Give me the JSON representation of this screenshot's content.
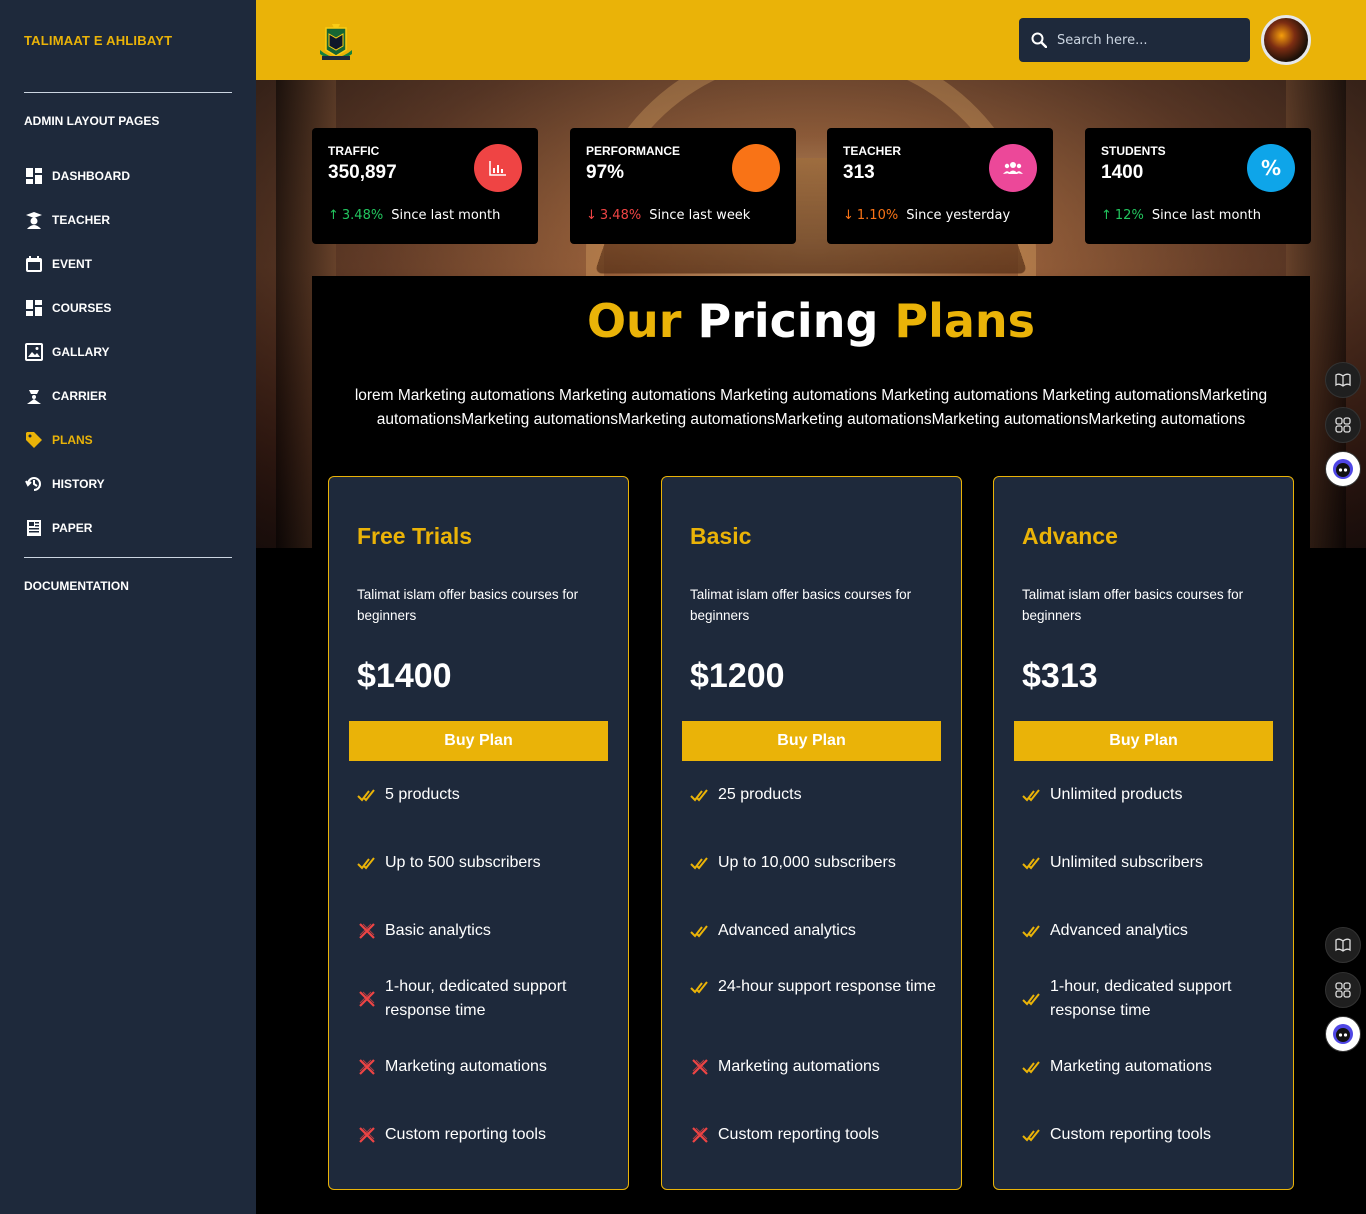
{
  "sidebar": {
    "brand": "TALIMAAT E AHLIBAYT",
    "section_heading": "ADMIN LAYOUT PAGES",
    "items": [
      {
        "label": "DASHBOARD",
        "icon": "dashboard-icon"
      },
      {
        "label": "TEACHER",
        "icon": "teacher-icon"
      },
      {
        "label": "EVENT",
        "icon": "calendar-icon"
      },
      {
        "label": "COURSES",
        "icon": "courses-icon"
      },
      {
        "label": "GALLARY",
        "icon": "gallery-icon"
      },
      {
        "label": "CARRIER",
        "icon": "carrier-icon"
      },
      {
        "label": "PLANS",
        "icon": "tag-icon",
        "active": true
      },
      {
        "label": "HISTORY",
        "icon": "history-icon"
      },
      {
        "label": "PAPER",
        "icon": "newspaper-icon"
      }
    ],
    "documentation": "DOCUMENTATION"
  },
  "header": {
    "search_placeholder": "Search here..."
  },
  "stats": [
    {
      "title": "TRAFFIC",
      "value": "350,897",
      "trend": "up",
      "change": "3.48%",
      "since": "Since last month",
      "color": "#ef4444",
      "icon": "chart-icon"
    },
    {
      "title": "PERFORMANCE",
      "value": "97%",
      "trend": "down",
      "change": "3.48%",
      "since": "Since last week",
      "color": "#f97316",
      "icon": "pie-icon"
    },
    {
      "title": "TEACHER",
      "value": "313",
      "trend": "down",
      "change": "1.10%",
      "since": "Since yesterday",
      "color": "#ec4899",
      "icon": "users-icon"
    },
    {
      "title": "STUDENTS",
      "value": "1400",
      "trend": "up",
      "change": "12%",
      "since": "Since last month",
      "color": "#0ea5e9",
      "icon": "percent-icon"
    }
  ],
  "pricing": {
    "title_part1": "Our",
    "title_part2": "Pricing",
    "title_part3": "Plans",
    "intro": "lorem Marketing automations Marketing automations Marketing automations Marketing automations Marketing automationsMarketing automationsMarketing automationsMarketing automationsMarketing automationsMarketing automationsMarketing automations",
    "plans": [
      {
        "name": "Free Trials",
        "description": "Talimat islam offer basics courses for beginners",
        "price": "$1400",
        "button": "Buy Plan",
        "features": [
          {
            "text": "5 products",
            "included": true
          },
          {
            "text": "Up to 500 subscribers",
            "included": true
          },
          {
            "text": "Basic analytics",
            "included": false
          },
          {
            "text": "1-hour, dedicated support response time",
            "included": false
          },
          {
            "text": "Marketing automations",
            "included": false
          },
          {
            "text": "Custom reporting tools",
            "included": false
          }
        ]
      },
      {
        "name": "Basic",
        "description": "Talimat islam offer basics courses for beginners",
        "price": "$1200",
        "button": "Buy Plan",
        "features": [
          {
            "text": "25 products",
            "included": true
          },
          {
            "text": "Up to 10,000 subscribers",
            "included": true
          },
          {
            "text": "Advanced analytics",
            "included": true
          },
          {
            "text": "24-hour support response time",
            "included": true
          },
          {
            "text": "Marketing automations",
            "included": false
          },
          {
            "text": "Custom reporting tools",
            "included": false
          }
        ]
      },
      {
        "name": "Advance",
        "description": "Talimat islam offer basics courses for beginners",
        "price": "$313",
        "button": "Buy Plan",
        "features": [
          {
            "text": "Unlimited products",
            "included": true
          },
          {
            "text": "Unlimited subscribers",
            "included": true
          },
          {
            "text": "Advanced analytics",
            "included": true
          },
          {
            "text": "1-hour, dedicated support response time",
            "included": true
          },
          {
            "text": "Marketing automations",
            "included": true
          },
          {
            "text": "Custom reporting tools",
            "included": true
          }
        ]
      }
    ]
  },
  "colors": {
    "accent": "#eab308",
    "sidebar_bg": "#1e293b",
    "card_bg": "#1e293b",
    "check": "#eab308",
    "cross": "#ef4444"
  }
}
